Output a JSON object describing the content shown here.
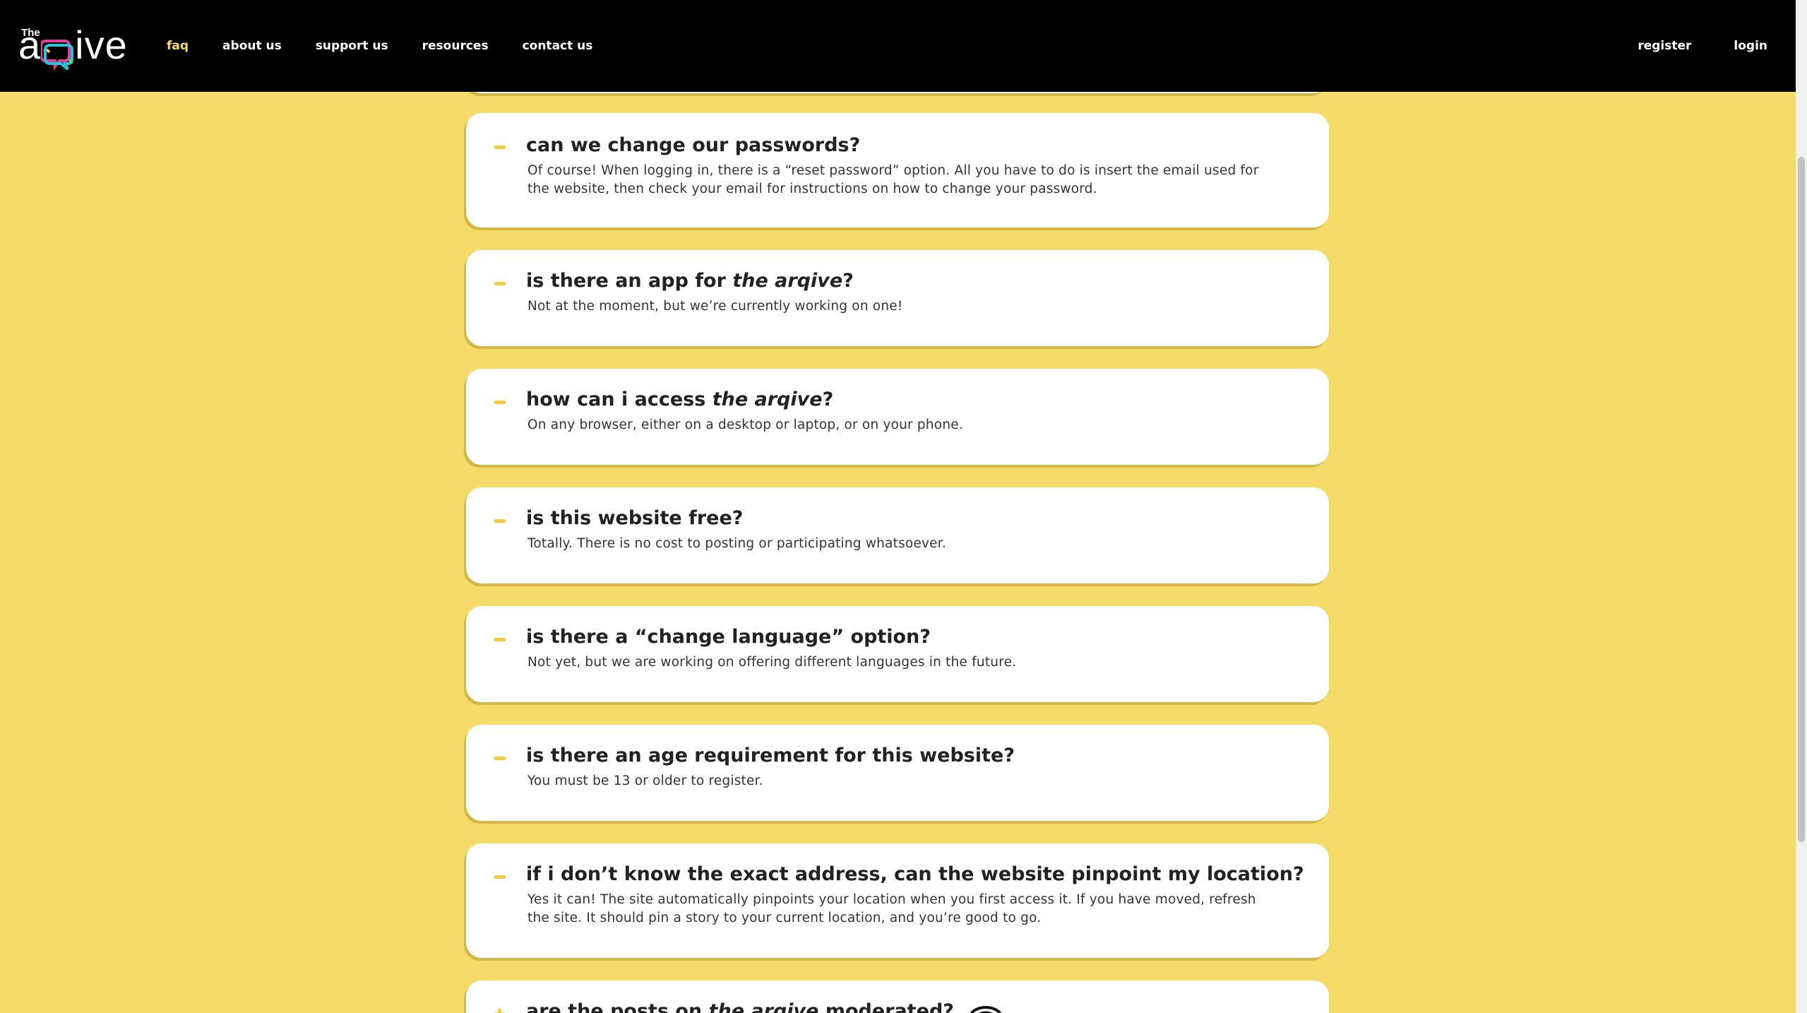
{
  "nav": {
    "logo_small": "The",
    "logo_word_left": "a",
    "logo_word_q": "q",
    "logo_word_right": "ive",
    "links": [
      "faq",
      "about us",
      "support us",
      "resources",
      "contact us"
    ],
    "register": "register",
    "login": "login"
  },
  "faqs": [
    {
      "q_pre": "can we change our passwords?",
      "q_em": "",
      "q_post": "",
      "a": "Of course! When logging in, there is a “reset password” option. All you have to do is insert the email used for the website, then check your email for instructions on how to change your password."
    },
    {
      "q_pre": "is there an app for ",
      "q_em": "the arqive",
      "q_post": "?",
      "a": "Not at the moment, but we’re currently working on one!"
    },
    {
      "q_pre": "how can i access ",
      "q_em": "the arqive",
      "q_post": "?",
      "a": "On any browser, either on a desktop or laptop, or on your phone."
    },
    {
      "q_pre": "is this website free?",
      "q_em": "",
      "q_post": "",
      "a": "Totally. There is no cost to posting or participating whatsoever."
    },
    {
      "q_pre": "is there a “change language” option?",
      "q_em": "",
      "q_post": "",
      "a": "Not yet, but we are working on offering different languages in the future."
    },
    {
      "q_pre": "is there an age requirement for this website?",
      "q_em": "",
      "q_post": "",
      "a": "You must be 13 or older to register."
    },
    {
      "q_pre": "if i don’t know the exact address, can the website pinpoint my location?",
      "q_em": "",
      "q_post": "",
      "a": "Yes it can! The site automatically pinpoints your location when you first access it. If you have moved, refresh the site. It should pin a story to your current location, and you’re good to go."
    },
    {
      "q_pre": "are the posts on ",
      "q_em": "the arqive",
      "q_post": " moderated?",
      "a": ""
    }
  ],
  "colors": {
    "background": "#f5db6a",
    "nav_bg": "#000000",
    "accent": "#f5c842",
    "card": "#ffffff"
  }
}
